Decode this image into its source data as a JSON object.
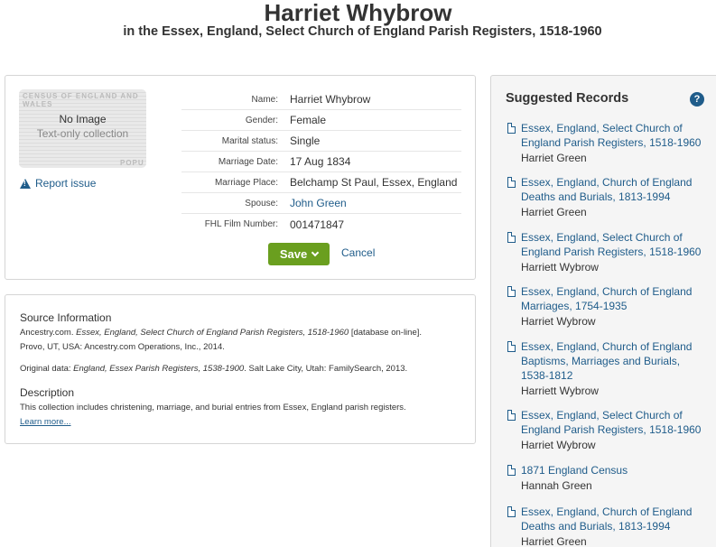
{
  "header": {
    "title": "Harriet Whybrow",
    "subtitle": "in the Essex, England, Select Church of England Parish Registers, 1518-1960"
  },
  "record": {
    "thumbnail": {
      "watermark": "CENSUS OF ENGLAND AND WALES",
      "watermark2": "POPU",
      "no_image": "No Image",
      "text_only": "Text-only collection"
    },
    "report_issue": "Report issue",
    "fields": [
      {
        "label": "Name:",
        "value": "Harriet Whybrow"
      },
      {
        "label": "Gender:",
        "value": "Female"
      },
      {
        "label": "Marital status:",
        "value": "Single"
      },
      {
        "label": "Marriage Date:",
        "value": "17 Aug 1834"
      },
      {
        "label": "Marriage Place:",
        "value": "Belchamp St Paul, Essex, England"
      },
      {
        "label": "Spouse:",
        "value": "John Green"
      },
      {
        "label": "FHL Film Number:",
        "value": "001471847"
      }
    ],
    "save_label": "Save",
    "cancel_label": "Cancel"
  },
  "source": {
    "heading": "Source Information",
    "citation_prefix": "Ancestry.com. ",
    "citation_title": "Essex, England, Select Church of England Parish Registers, 1518-1960",
    "citation_suffix": " [database on-line].",
    "citation_line2": "Provo, UT, USA: Ancestry.com Operations, Inc., 2014.",
    "original_prefix": "Original data: ",
    "original_title": "England, Essex Parish Registers, 1538-1900",
    "original_suffix": ". Salt Lake City, Utah: FamilySearch, 2013.",
    "description_heading": "Description",
    "description_text": "This collection includes christening, marriage, and burial entries from Essex, England parish registers.",
    "learn_more": "Learn more..."
  },
  "suggested": {
    "title": "Suggested Records",
    "help": "?",
    "items": [
      {
        "title": "Essex, England, Select Church of England Parish Registers, 1518-1960",
        "name": "Harriet Green"
      },
      {
        "title": "Essex, England, Church of England Deaths and Burials, 1813-1994",
        "name": "Harriet Green"
      },
      {
        "title": "Essex, England, Select Church of England Parish Registers, 1518-1960",
        "name": "Harriett Wybrow"
      },
      {
        "title": "Essex, England, Church of England Marriages, 1754-1935",
        "name": "Harriet Wybrow"
      },
      {
        "title": "Essex, England, Church of England Baptisms, Marriages and Burials, 1538-1812",
        "name": "Harriett Wybrow"
      },
      {
        "title": "Essex, England, Select Church of England Parish Registers, 1518-1960",
        "name": "Harriet Wybrow"
      },
      {
        "title": "1871 England Census",
        "name": "Hannah Green"
      },
      {
        "title": "Essex, England, Church of England Deaths and Burials, 1813-1994",
        "name": "Harriet Green"
      }
    ]
  }
}
